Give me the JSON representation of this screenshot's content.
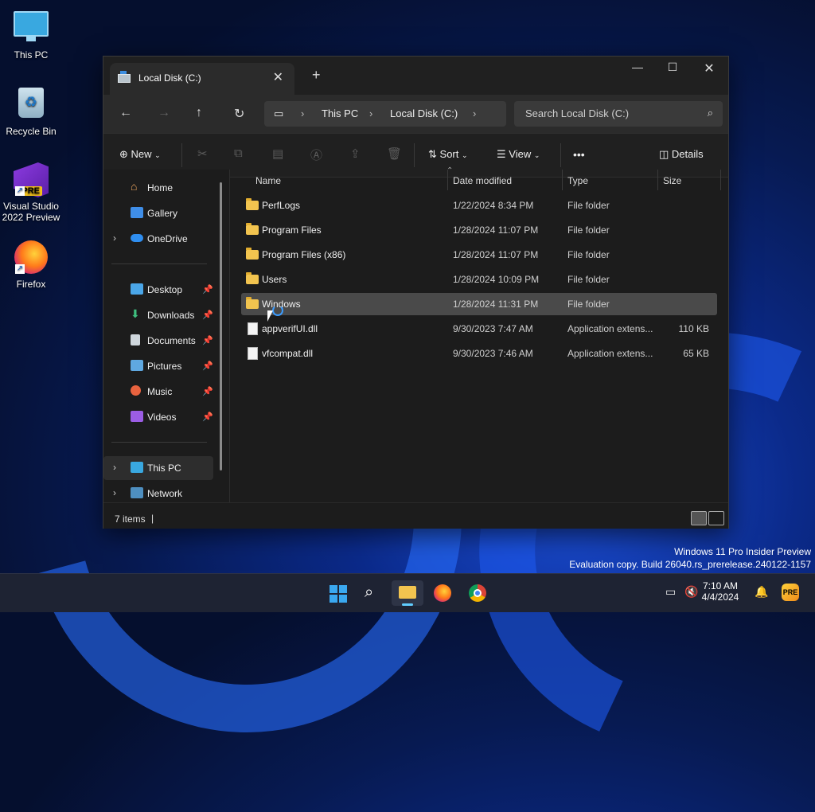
{
  "desktop": {
    "icons": [
      {
        "label": "This PC"
      },
      {
        "label": "Recycle Bin"
      },
      {
        "label": "Visual Studio 2022 Preview",
        "badge": "PRE"
      },
      {
        "label": "Firefox"
      }
    ],
    "watermark": {
      "line1": "Windows 11 Pro Insider Preview",
      "line2": "Evaluation copy. Build 26040.rs_prerelease.240122-1157"
    }
  },
  "window": {
    "tab_title": "Local Disk (C:)",
    "tab_close": "✕",
    "new_tab": "+",
    "controls": {
      "minimize": "—",
      "maximize": "☐",
      "close": "✕"
    },
    "nav": {
      "back": "←",
      "forward": "→",
      "up": "↑",
      "refresh": "↻"
    },
    "breadcrumb": [
      "This PC",
      "Local Disk (C:)"
    ],
    "search_placeholder": "Search Local Disk (C:)",
    "toolbar": {
      "new_label": "New",
      "sort_label": "Sort",
      "view_label": "View",
      "more_label": "•••",
      "details_label": "Details"
    },
    "sidebar": {
      "top": [
        {
          "label": "Home"
        },
        {
          "label": "Gallery"
        },
        {
          "label": "OneDrive"
        }
      ],
      "quick": [
        {
          "label": "Desktop"
        },
        {
          "label": "Downloads"
        },
        {
          "label": "Documents"
        },
        {
          "label": "Pictures"
        },
        {
          "label": "Music"
        },
        {
          "label": "Videos"
        }
      ],
      "bottom": [
        {
          "label": "This PC"
        },
        {
          "label": "Network"
        }
      ]
    },
    "columns": {
      "name": "Name",
      "date": "Date modified",
      "type": "Type",
      "size": "Size"
    },
    "files": [
      {
        "name": "PerfLogs",
        "date": "1/22/2024 8:34 PM",
        "type": "File folder",
        "size": ""
      },
      {
        "name": "Program Files",
        "date": "1/28/2024 11:07 PM",
        "type": "File folder",
        "size": ""
      },
      {
        "name": "Program Files (x86)",
        "date": "1/28/2024 11:07 PM",
        "type": "File folder",
        "size": ""
      },
      {
        "name": "Users",
        "date": "1/28/2024 10:09 PM",
        "type": "File folder",
        "size": ""
      },
      {
        "name": "Windows",
        "date": "1/28/2024 11:31 PM",
        "type": "File folder",
        "size": ""
      },
      {
        "name": "appverifUI.dll",
        "date": "9/30/2023 7:47 AM",
        "type": "Application extens...",
        "size": "110 KB"
      },
      {
        "name": "vfcompat.dll",
        "date": "9/30/2023 7:46 AM",
        "type": "Application extens...",
        "size": "65 KB"
      }
    ],
    "status": {
      "count": "7 items"
    }
  },
  "taskbar": {
    "time": "7:10 AM",
    "date": "4/4/2024"
  },
  "colors": {
    "accent": "#60cdff",
    "folder": "#f2c44f",
    "selection": "#4a4a4a"
  }
}
